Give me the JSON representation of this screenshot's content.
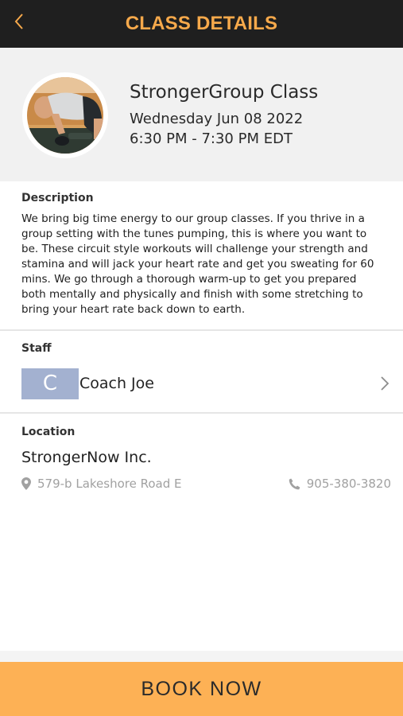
{
  "header": {
    "title": "CLASS DETAILS",
    "back_icon": "chevron-left-icon",
    "accent_color": "#f6a94b"
  },
  "class": {
    "name": "StrongerGroup Class",
    "date": "Wednesday Jun 08 2022",
    "time": "6:30 PM - 7:30 PM EDT"
  },
  "description": {
    "label": "Description",
    "text": "We bring big time energy to our group classes. If you thrive in a group setting with the tunes pumping, this is where you want to be. These circuit style workouts  will challenge your strength and stamina and will jack your heart rate and get you sweating for 60 mins. We go through a thorough warm-up to get you prepared both mentally and physically and finish with some stretching to bring your heart rate back down to earth."
  },
  "staff": {
    "label": "Staff",
    "initial": "C",
    "name": "Coach Joe",
    "chevron_icon": "chevron-right-icon"
  },
  "location": {
    "label": "Location",
    "name": "StrongerNow Inc.",
    "address": "579-b Lakeshore Road E",
    "address_icon": "map-pin-icon",
    "phone": "905-380-3820",
    "phone_icon": "phone-icon"
  },
  "footer": {
    "book_label": "BOOK NOW",
    "button_color": "#fdb155"
  }
}
